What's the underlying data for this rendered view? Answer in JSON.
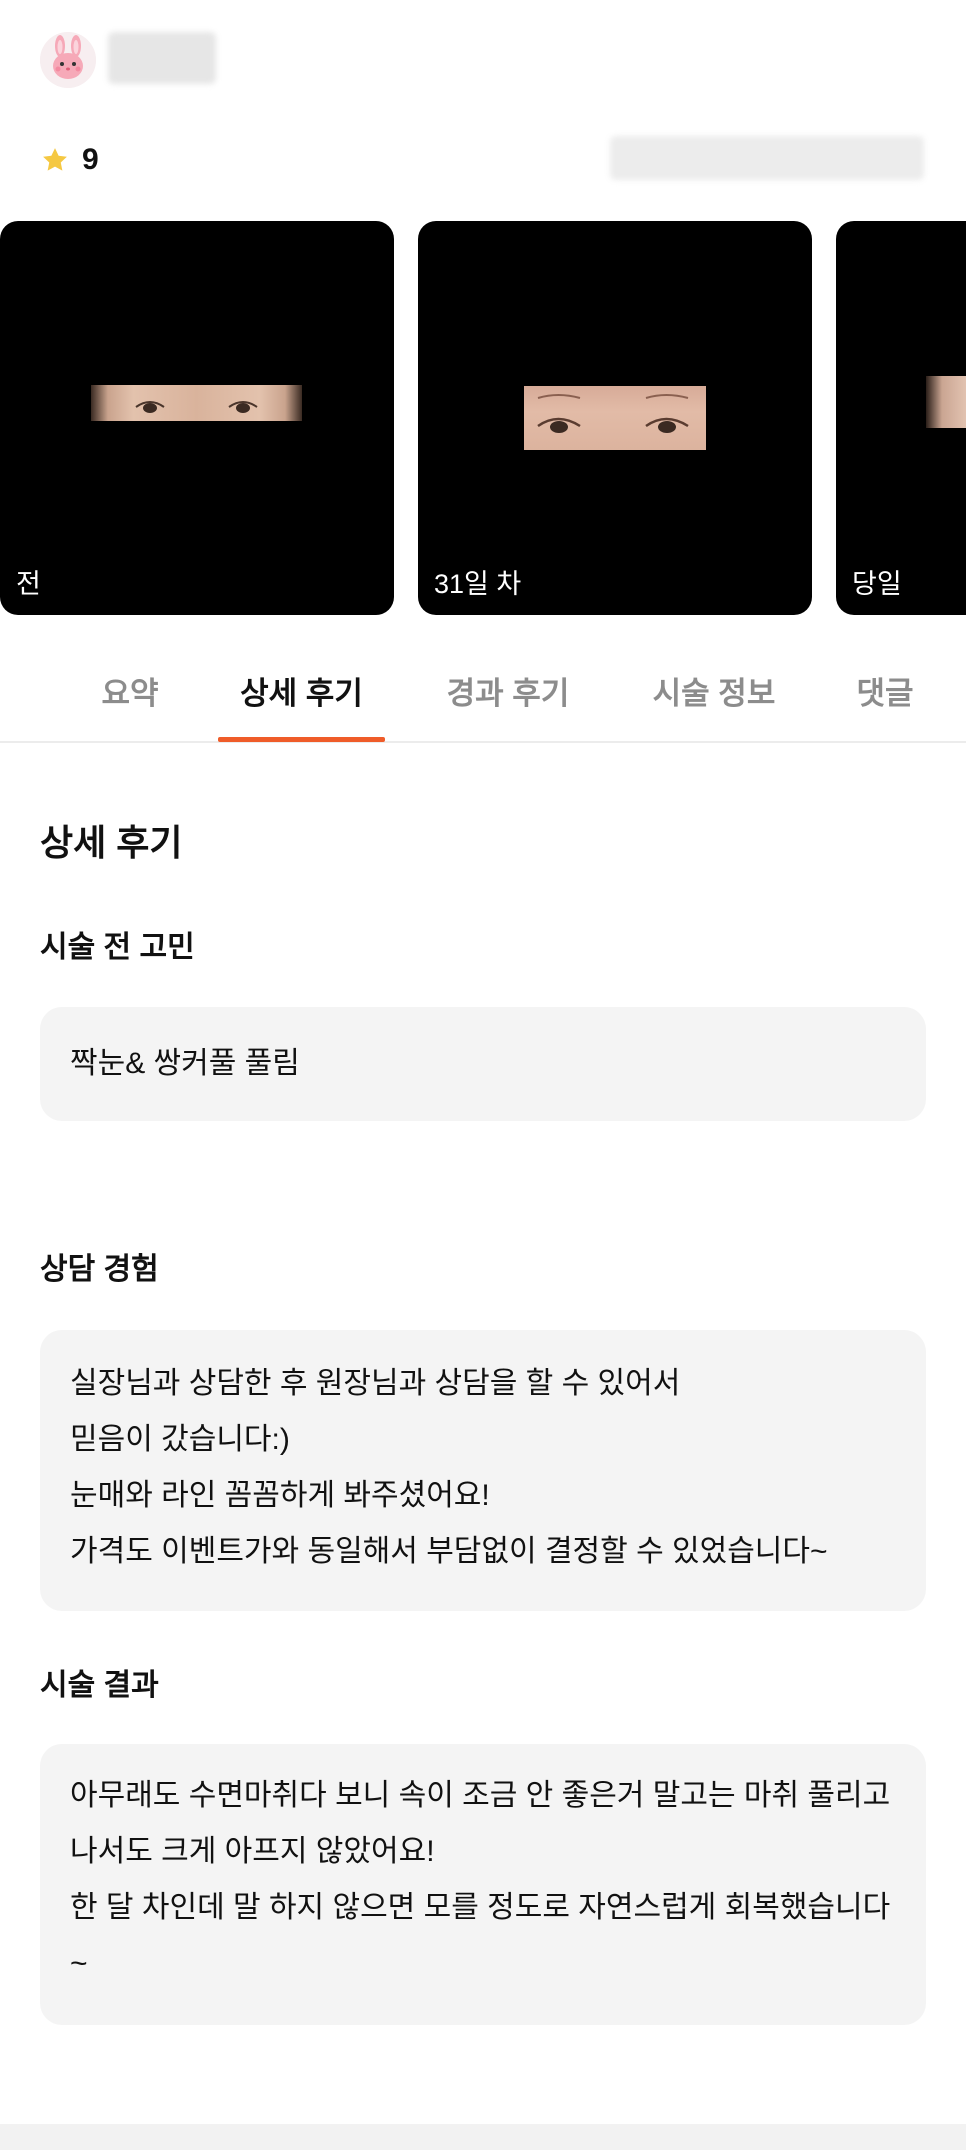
{
  "header": {
    "rating_value": "9",
    "icons": {
      "avatar": "rabbit-avatar-icon",
      "rating": "star-icon"
    },
    "colors": {
      "star": "#f5c842",
      "accent": "#ef5c29"
    }
  },
  "gallery": {
    "photos": [
      {
        "caption": "전"
      },
      {
        "caption": "31일 차"
      },
      {
        "caption": "당일"
      }
    ]
  },
  "tabs": [
    {
      "label": "요약",
      "active": false
    },
    {
      "label": "상세 후기",
      "active": true
    },
    {
      "label": "경과 후기",
      "active": false
    },
    {
      "label": "시술 정보",
      "active": false
    },
    {
      "label": "댓글",
      "active": false
    }
  ],
  "detail": {
    "title": "상세 후기",
    "sections": [
      {
        "heading": "시술 전 고민",
        "lines": [
          "짝눈& 쌍커풀 풀림"
        ]
      },
      {
        "heading": "상담 경험",
        "lines": [
          "실장님과 상담한 후 원장님과 상담을 할 수 있어서",
          "믿음이 갔습니다:)",
          "눈매와 라인 꼼꼼하게 봐주셨어요!",
          "가격도 이벤트가와 동일해서 부담없이 결정할 수 있었습니다~"
        ]
      },
      {
        "heading": "시술 결과",
        "lines": [
          "아무래도 수면마취다 보니 속이 조금 안 좋은거 말고는 마취 풀리고",
          "나서도 크게 아프지 않았어요!",
          "한 달 차인데 말 하지 않으면 모를 정도로 자연스럽게 회복했습니다",
          "~"
        ]
      }
    ]
  }
}
